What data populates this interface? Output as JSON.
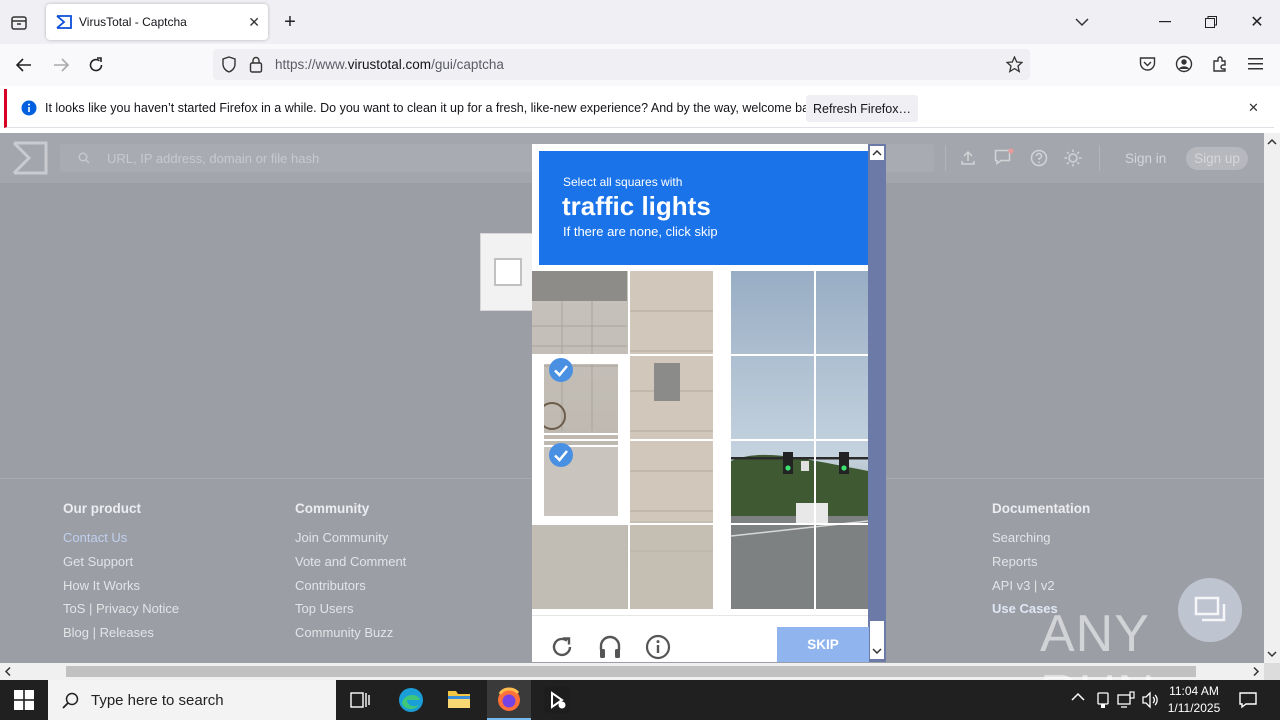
{
  "browser": {
    "tab_title": "VirusTotal - Captcha",
    "url_prefix": "https://www.",
    "url_domain": "virustotal.com",
    "url_path": "/gui/captcha",
    "notification": "It looks like you haven’t started Firefox in a while. Do you want to clean it up for a fresh, like-new experience? And by the way, welcome back!",
    "refresh_button": "Refresh Firefox…"
  },
  "vt": {
    "search_placeholder": "URL, IP address, domain or file hash",
    "sign_in": "Sign in",
    "sign_up": "Sign up"
  },
  "footer": {
    "col1": {
      "title": "Our product",
      "items": [
        "Contact Us",
        "Get Support",
        "How It Works",
        "ToS | Privacy Notice",
        "Blog | Releases"
      ]
    },
    "col2": {
      "title": "Community",
      "items": [
        "Join Community",
        "Vote and Comment",
        "Contributors",
        "Top Users",
        "Community Buzz"
      ]
    },
    "col4": {
      "title": "Documentation",
      "items": [
        "Searching",
        "Reports",
        "API v3 | v2",
        "Use Cases"
      ]
    }
  },
  "captcha": {
    "line1": "Select all squares with",
    "target": "traffic lights",
    "line3": "If there are none, click skip",
    "skip": "SKIP"
  },
  "taskbar": {
    "search_placeholder": "Type here to search",
    "time": "11:04 AM",
    "date": "1/11/2025"
  },
  "watermark": "ANY RUN",
  "colors": {
    "accent": "#1a73e8",
    "notif_bar": "#d70022"
  }
}
